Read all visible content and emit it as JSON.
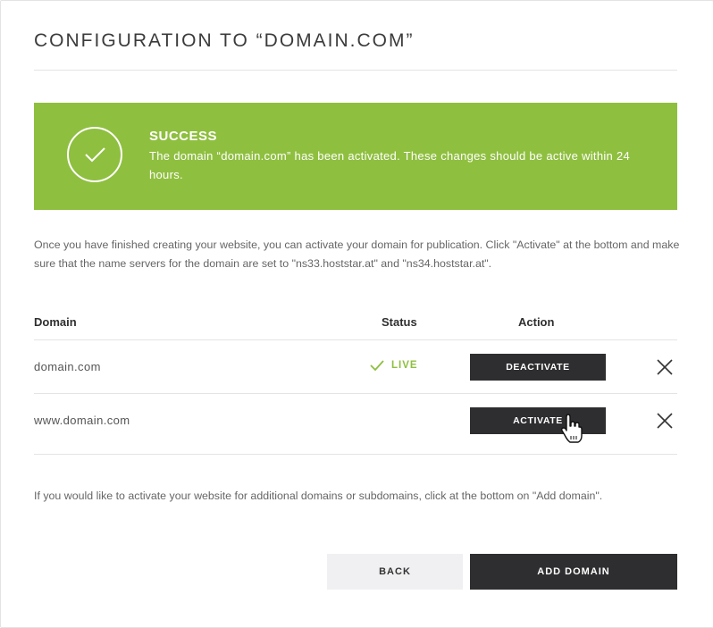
{
  "dialog": {
    "title": "CONFIGURATION TO “DOMAIN.COM”"
  },
  "banner": {
    "color": "#8fbf3f",
    "icon": "check-circle-icon",
    "title": "SUCCESS",
    "message": "The domain “domain.com” has been activated. These changes should be active within 24 hours."
  },
  "intro": "Once you have finished creating your website, you can activate your domain for publication. Click \"Activate\" at the bottom and make sure that the name servers for the domain are set to \"ns33.hoststar.at\" and \"ns34.hoststar.at\".",
  "table": {
    "headers": {
      "domain": "Domain",
      "status": "Status",
      "action": "Action"
    },
    "rows": [
      {
        "domain": "domain.com",
        "status": "LIVE",
        "status_icon": "checkmark-icon",
        "action": "DEACTIVATE",
        "remove_icon": "close-icon"
      },
      {
        "domain": "www.domain.com",
        "status": "",
        "action": "ACTIVATE",
        "remove_icon": "close-icon"
      }
    ]
  },
  "footer_text": "If you would like to activate your website for additional domains or subdomains, click at the bottom on \"Add domain\".",
  "buttons": {
    "back": "BACK",
    "add_domain": "ADD DOMAIN"
  }
}
